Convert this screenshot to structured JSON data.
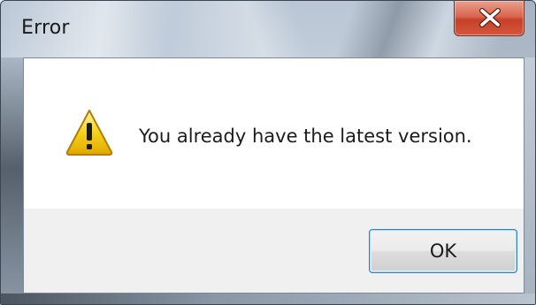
{
  "window": {
    "title": "Error",
    "close_icon": "close-x-icon"
  },
  "dialog": {
    "icon": "warning-icon",
    "message": "You already have the latest version.",
    "ok_label": "OK"
  },
  "colors": {
    "close_button": "#d9664f",
    "ok_button_border": "#3c7fb1",
    "warning_icon": "#f5c400"
  }
}
